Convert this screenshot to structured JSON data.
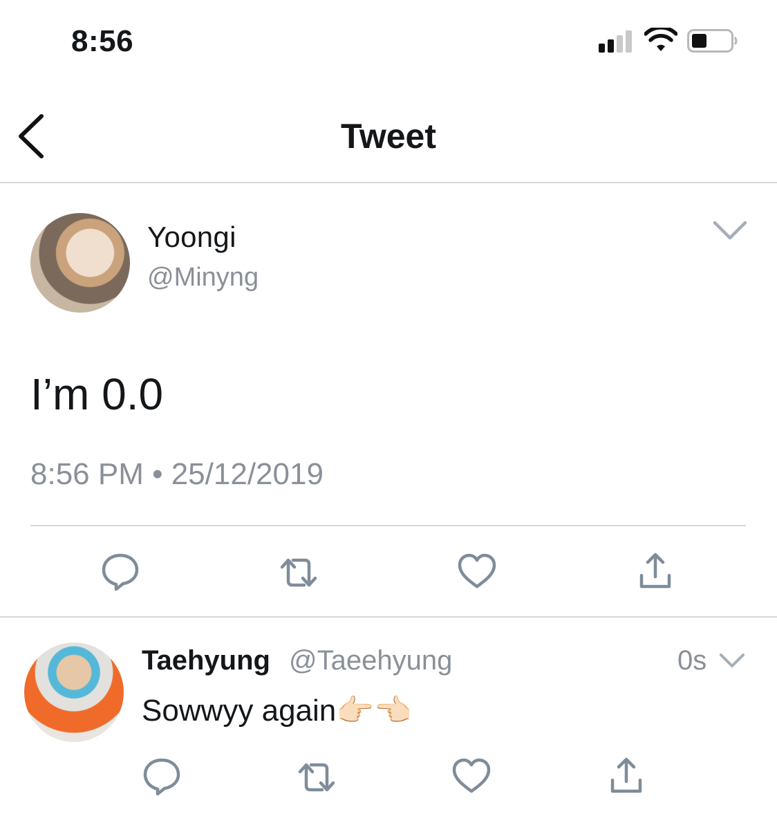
{
  "status_bar": {
    "time": "8:56"
  },
  "nav": {
    "title": "Tweet"
  },
  "tweet": {
    "author_name": "Yoongi",
    "author_handle": "@Minyng",
    "text": "I’m 0.0",
    "timestamp": "8:56 PM • 25/12/2019"
  },
  "reply": {
    "author_name": "Taehyung",
    "author_handle": "@Taeehyung",
    "time": "0s",
    "text": "Sowwyy again👉🏻👈🏻"
  },
  "icons": {
    "back": "chevron-left-icon",
    "more": "chevron-down-icon",
    "reply": "comment-icon",
    "retweet": "retweet-icon",
    "like": "heart-icon",
    "share": "share-icon"
  },
  "colors": {
    "text": "#14171a",
    "secondary": "#8a9099",
    "icon": "#7f8c99",
    "divider": "#d6d6d8",
    "background": "#ffffff"
  }
}
